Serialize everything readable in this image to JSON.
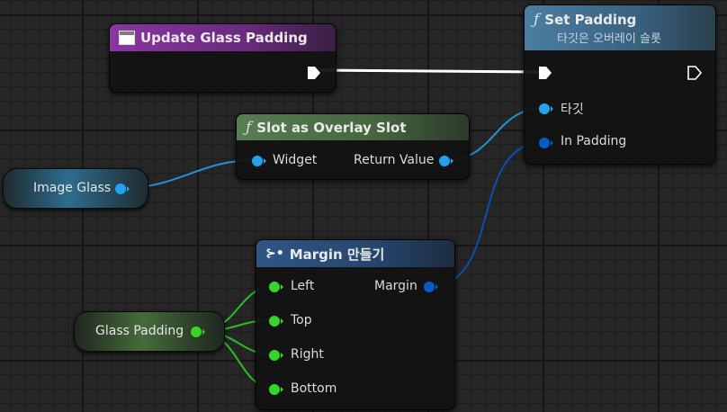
{
  "nodes": {
    "update_glass_padding": {
      "title": "Update Glass Padding"
    },
    "set_padding": {
      "title": "Set Padding",
      "subtitle": "타깃은 오버레이 슬롯",
      "pins": {
        "target": "타깃",
        "in_padding": "In Padding"
      }
    },
    "slot_as_overlay_slot": {
      "title": "Slot as Overlay Slot",
      "pins": {
        "widget": "Widget",
        "return_value": "Return Value"
      }
    },
    "make_margin": {
      "title": "Margin 만들기",
      "pins": {
        "left": "Left",
        "top": "Top",
        "right": "Right",
        "bottom": "Bottom",
        "margin": "Margin"
      }
    }
  },
  "variables": {
    "image_glass": "Image Glass",
    "glass_padding": "Glass Padding"
  },
  "icons": {
    "function": "function-icon",
    "event": "event-icon",
    "make_struct": "make-struct-icon"
  },
  "colors": {
    "event_header": "#7e2f8e",
    "function_header_blue": "#3c6a8a",
    "function_header_green": "#4a6e45",
    "make_header": "#2c4f7c",
    "object_pin": "#21a4ee",
    "struct_pin": "#0a59c8",
    "float_pin": "#35d52a",
    "exec_pin": "#ffffff"
  }
}
